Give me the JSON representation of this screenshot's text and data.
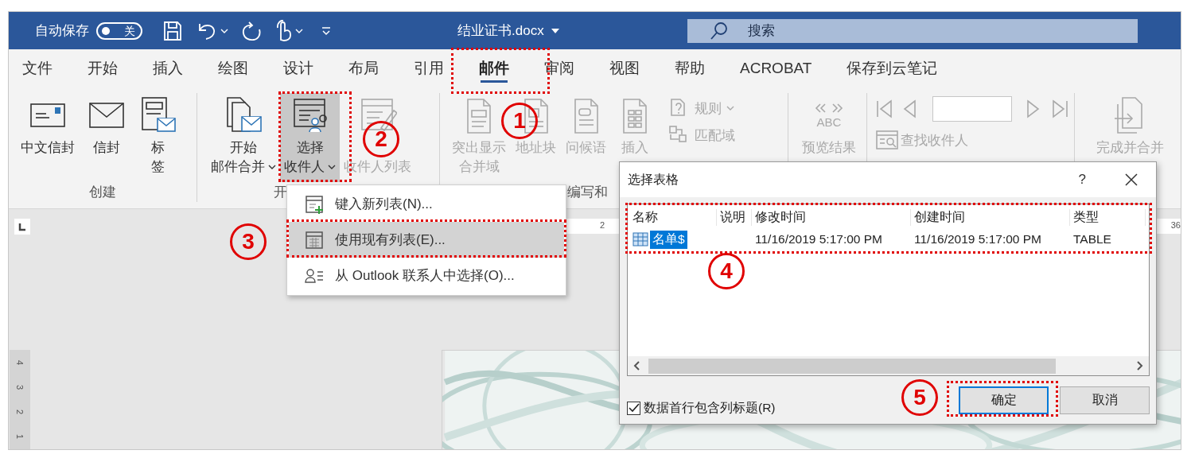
{
  "title_bar": {
    "autosave_label": "自动保存",
    "autosave_state": "关",
    "autosave_on": false,
    "document_title": "结业证书.docx",
    "search_placeholder": "搜索"
  },
  "tabs": [
    {
      "label": "文件",
      "selected": false
    },
    {
      "label": "开始",
      "selected": false
    },
    {
      "label": "插入",
      "selected": false
    },
    {
      "label": "绘图",
      "selected": false
    },
    {
      "label": "设计",
      "selected": false
    },
    {
      "label": "布局",
      "selected": false
    },
    {
      "label": "引用",
      "selected": false
    },
    {
      "label": "邮件",
      "selected": true
    },
    {
      "label": "审阅",
      "selected": false
    },
    {
      "label": "视图",
      "selected": false
    },
    {
      "label": "帮助",
      "selected": false
    },
    {
      "label": "ACROBAT",
      "selected": false
    },
    {
      "label": "保存到云笔记",
      "selected": false
    }
  ],
  "ribbon": {
    "groups": [
      {
        "label": "创建",
        "buttons": [
          {
            "kind": "large",
            "lines": [
              "中文信封"
            ],
            "disabled": false,
            "pressed": false,
            "dropdown": false
          },
          {
            "kind": "large",
            "lines": [
              "信封"
            ],
            "disabled": false,
            "pressed": false,
            "dropdown": false
          },
          {
            "kind": "large",
            "lines": [
              "标",
              "签"
            ],
            "disabled": false,
            "pressed": false,
            "dropdown": false
          }
        ]
      },
      {
        "label": "开",
        "buttons": [
          {
            "kind": "large",
            "lines": [
              "开始",
              "邮件合并"
            ],
            "disabled": false,
            "pressed": false,
            "dropdown": true
          },
          {
            "kind": "large",
            "lines": [
              "选择",
              "收件人"
            ],
            "disabled": false,
            "pressed": true,
            "dropdown": true
          },
          {
            "kind": "large",
            "lines": [
              "收件人列表"
            ],
            "disabled": true,
            "pressed": false,
            "dropdown": false
          }
        ]
      },
      {
        "label": "编写和",
        "buttons": [
          {
            "kind": "large",
            "lines": [
              "突出显示",
              "合并域"
            ],
            "disabled": true,
            "pressed": false,
            "dropdown": false
          },
          {
            "kind": "large",
            "lines": [
              "地址块"
            ],
            "disabled": true,
            "pressed": false,
            "dropdown": false
          },
          {
            "kind": "large",
            "lines": [
              "问候语"
            ],
            "disabled": true,
            "pressed": false,
            "dropdown": false
          },
          {
            "kind": "large",
            "lines": [
              "插入"
            ],
            "disabled": true,
            "pressed": false,
            "dropdown": false
          },
          {
            "kind": "stack",
            "items": [
              {
                "label": "规则",
                "disabled": true,
                "dropdown": true
              },
              {
                "label": "匹配域",
                "disabled": true,
                "dropdown": false
              }
            ]
          }
        ]
      },
      {
        "buttons": [
          {
            "kind": "large",
            "lines": [
              "预览结果"
            ],
            "icon_text": "ABC",
            "disabled": true,
            "pressed": false,
            "dropdown": false
          },
          {
            "kind": "nav",
            "disabled": true,
            "items": [
              {
                "label": "查找收件人",
                "disabled": true,
                "dropdown": false
              }
            ]
          }
        ]
      },
      {
        "buttons": [
          {
            "kind": "large",
            "lines": [
              "完成并合并"
            ],
            "disabled": true,
            "pressed": false,
            "dropdown": false
          }
        ]
      }
    ]
  },
  "document": {
    "ruler_marks": [
      "2",
      "36"
    ],
    "vertical_ruler": [
      "4",
      "3",
      "2",
      "1"
    ],
    "background": {
      "kind": "picture"
    }
  },
  "menu": {
    "items": [
      {
        "label": "键入新列表(N)...",
        "selected": false
      },
      {
        "label": "使用现有列表(E)...",
        "selected": true
      },
      {
        "label": "从 Outlook 联系人中选择(O)...",
        "selected": false
      }
    ]
  },
  "dialog": {
    "title": "选择表格",
    "help": "?",
    "columns": [
      "名称",
      "说明",
      "修改时间",
      "创建时间",
      "类型"
    ],
    "rows": [
      {
        "name": "名单$",
        "modified": "11/16/2019 5:17:00 PM",
        "created": "11/16/2019 5:17:00 PM",
        "type": "TABLE",
        "selected": true
      }
    ],
    "checkbox": {
      "label": "数据首行包含列标题(R)",
      "checked": true
    },
    "buttons": [
      {
        "label": "确定",
        "default": true
      },
      {
        "label": "取消",
        "default": false
      }
    ]
  },
  "annotations": [
    {
      "number": "1"
    },
    {
      "number": "2"
    },
    {
      "number": "3"
    },
    {
      "number": "4"
    },
    {
      "number": "5"
    }
  ]
}
